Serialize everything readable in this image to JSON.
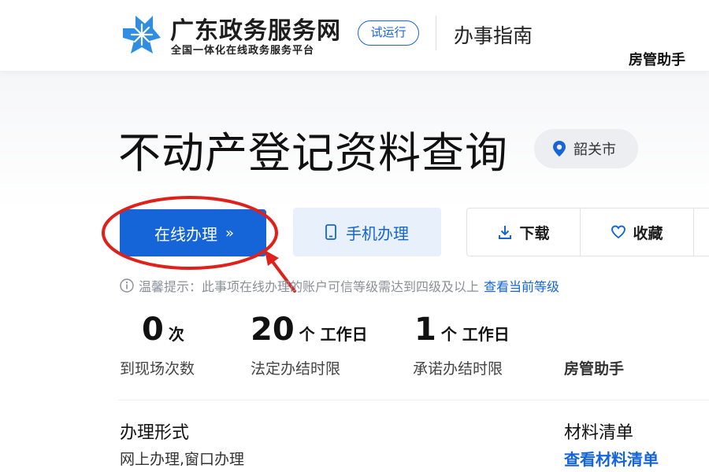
{
  "header": {
    "site_title": "广东政务服务网",
    "site_subtitle": "全国一体化在线政务服务平台",
    "trial_badge": "试运行",
    "guide_label": "办事指南",
    "watermark": "房管助手"
  },
  "page": {
    "title": "不动产登记资料查询",
    "city": "韶关市"
  },
  "actions": {
    "online_label": "在线办理",
    "online_chevron": "»",
    "mobile_label": "手机办理",
    "download_label": "下载",
    "favorite_label": "收藏"
  },
  "tip": {
    "text": "温馨提示：此事项在线办理的账户可信等级需达到四级及以上",
    "link": "查看当前等级"
  },
  "stats": [
    {
      "value": "0",
      "unit": "次",
      "label": "到现场次数"
    },
    {
      "value": "20",
      "unit": "个 工作日",
      "label": "法定办结时限"
    },
    {
      "value": "1",
      "unit": "个 工作日",
      "label": "承诺办结时限"
    }
  ],
  "watermark_mid": "房管助手",
  "details": {
    "form_title": "办理形式",
    "form_value": "网上办理,窗口办理",
    "materials_title": "材料清单",
    "materials_link": "查看材料清单"
  },
  "colors": {
    "primary": "#1565d8",
    "annotation": "#e0201b"
  },
  "icons": [
    "logo-icon",
    "location-pin-icon",
    "phone-icon",
    "download-icon",
    "heart-icon",
    "info-icon"
  ]
}
